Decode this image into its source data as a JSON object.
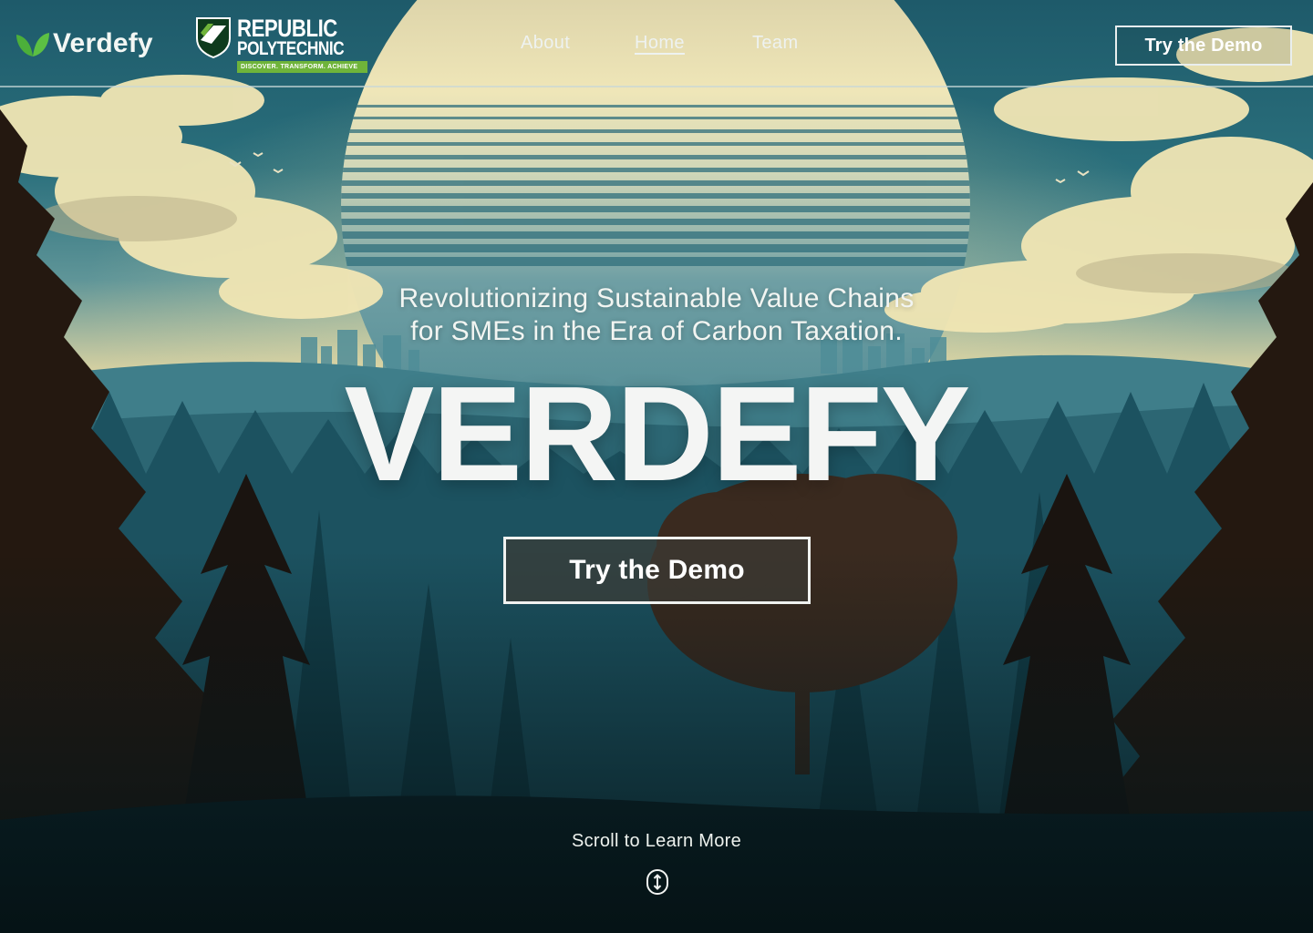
{
  "brand": {
    "name": "Verdefy",
    "leaf_color": "#4caf3a"
  },
  "partner_logo": {
    "line1": "REPUBLIC",
    "line2": "POLYTECHNIC",
    "tagline": "DISCOVER. TRANSFORM. ACHIEVE",
    "accent": "#6fb43a"
  },
  "nav": {
    "items": [
      {
        "label": "About",
        "active": false
      },
      {
        "label": "Home",
        "active": true
      },
      {
        "label": "Team",
        "active": false
      }
    ]
  },
  "header_cta": {
    "label": "Try the Demo"
  },
  "hero": {
    "tagline_line1": "Revolutionizing Sustainable Value Chains",
    "tagline_line2": "for SMEs in the Era of Carbon Taxation.",
    "title": "VERDEFY",
    "cta_label": "Try the Demo",
    "scroll_label": "Scroll to Learn More",
    "scroll_icon": "mouse-scroll-icon"
  }
}
